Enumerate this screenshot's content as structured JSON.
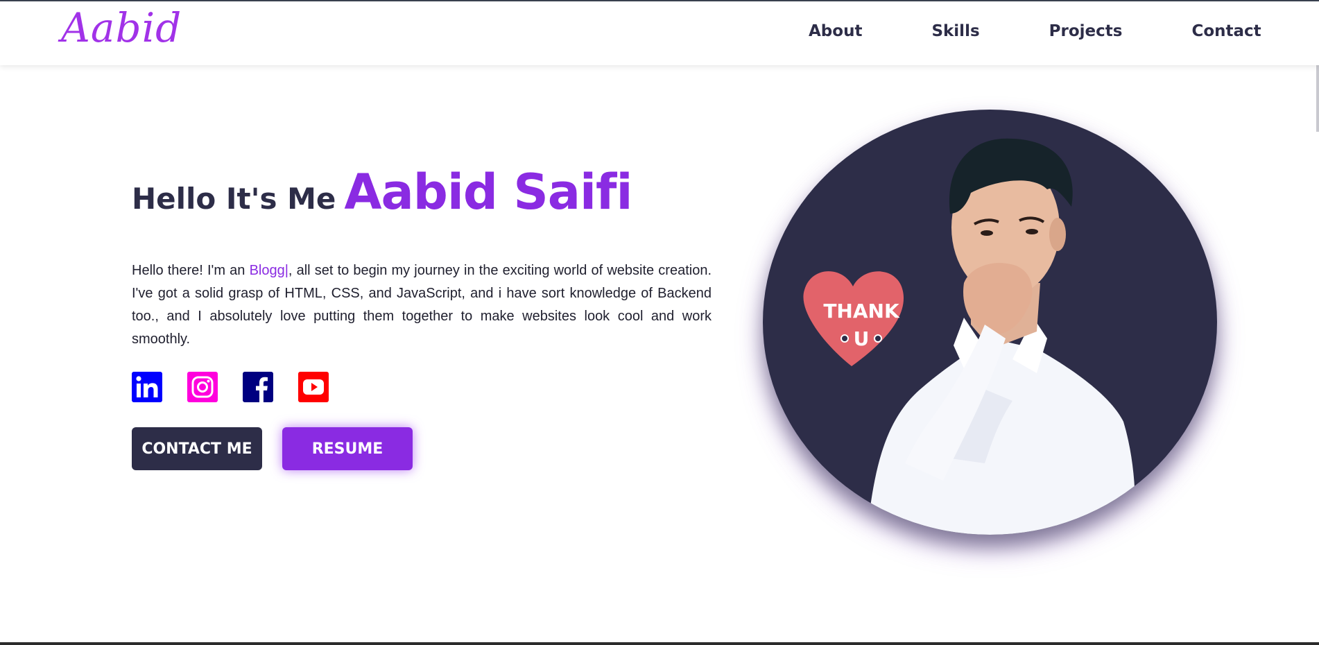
{
  "brand": {
    "logo_text": "Aabid",
    "color": "#a132e8"
  },
  "nav": {
    "items": [
      {
        "label": "About"
      },
      {
        "label": "Skills"
      },
      {
        "label": "Projects"
      },
      {
        "label": "Contact"
      }
    ]
  },
  "hero": {
    "greeting": "Hello It's Me",
    "name": "Aabid Saifi",
    "bio_before": "Hello there! I'm an ",
    "bio_role": "Blogg|",
    "bio_after": ", all set to begin my journey in the exciting world of website creation. I've got a solid grasp of HTML, CSS, and JavaScript, and i have sort knowledge of Backend too., and I absolutely love putting them together to make websites look cool and work smoothly.",
    "accent_color": "#8a2be2",
    "socials": [
      {
        "icon": "linkedin-icon",
        "color": "#0000ff"
      },
      {
        "icon": "instagram-icon",
        "color": "#ff00dd"
      },
      {
        "icon": "facebook-icon",
        "color": "#000080"
      },
      {
        "icon": "youtube-icon",
        "color": "#ff0000"
      }
    ],
    "buttons": {
      "contact_label": "CONTACT ME",
      "resume_label": "RESUME"
    }
  },
  "portrait": {
    "sticker_line1": "THANK",
    "sticker_line2": "U",
    "background_color": "#2d2d48"
  }
}
